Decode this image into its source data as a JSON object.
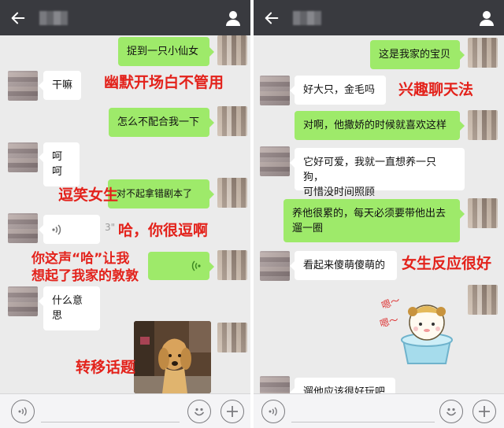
{
  "left": {
    "messages": {
      "m1": "捉到一只小仙女",
      "m2": "干嘛",
      "m3": "怎么不配合我一下",
      "m4": "呵呵",
      "m5": "对不起拿错剧本了",
      "voice_in_duration": "3\"",
      "m7": "什么意思"
    },
    "annotations": {
      "a1": "幽默开场白不管用",
      "a2": "逗笑女生",
      "a3": "哈，你很逗啊",
      "a4_line1": "你这声“哈”让我",
      "a4_line2": "想起了我家的敦敦",
      "a5": "转移话题"
    }
  },
  "right": {
    "messages": {
      "m1": "这是我家的宝贝",
      "m2": "好大只，金毛吗",
      "m3": "对啊，他撒娇的时候就喜欢这样",
      "m4_line1": "它好可爱，我就一直想养一只狗，",
      "m4_line2": "可惜没时间照顾",
      "m5_line1": "养他很累的，每天必须要带他出去",
      "m5_line2": "遛一圈",
      "m6": "看起来傻萌傻萌的",
      "m8": "遛他应该很好玩吧"
    },
    "annotations": {
      "a1": "兴趣聊天法",
      "a2": "女生反应很好"
    },
    "sticker_text": "嗯～"
  },
  "icons": [
    "back-arrow-icon",
    "person-icon",
    "voice-icon",
    "emoji-icon",
    "plus-icon",
    "voice-wave-icon",
    "golden-retriever-photo",
    "sticker-image"
  ],
  "colors": {
    "topbar": "#393a3f",
    "chat_bg": "#ebebeb",
    "outgoing_bubble": "#9eea6a",
    "incoming_bubble": "#ffffff",
    "annotation": "#e3221b"
  }
}
